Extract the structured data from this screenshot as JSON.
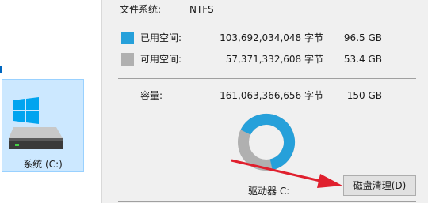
{
  "explorer": {
    "drive_label": "系统 (C:)"
  },
  "properties": {
    "fs_label": "文件系统:",
    "fs_value": "NTFS",
    "used_label": "已用空间:",
    "used_bytes": "103,692,034,048 字节",
    "used_size": "96.5 GB",
    "free_label": "可用空间:",
    "free_bytes": "57,371,332,608 字节",
    "free_size": "53.4 GB",
    "capacity_label": "容量:",
    "capacity_bytes": "161,063,366,656 字节",
    "capacity_size": "150 GB",
    "drive_caption": "驱动器 C:",
    "cleanup_button": "磁盘清理(D)"
  },
  "usage": {
    "used_fraction": 0.643,
    "free_fraction": 0.357
  },
  "colors": {
    "used": "#26a0da",
    "free": "#b0b0b0",
    "arrow": "#e0202e"
  },
  "icons": {
    "drive": "hard-drive-icon",
    "windows": "windows-logo-icon"
  }
}
